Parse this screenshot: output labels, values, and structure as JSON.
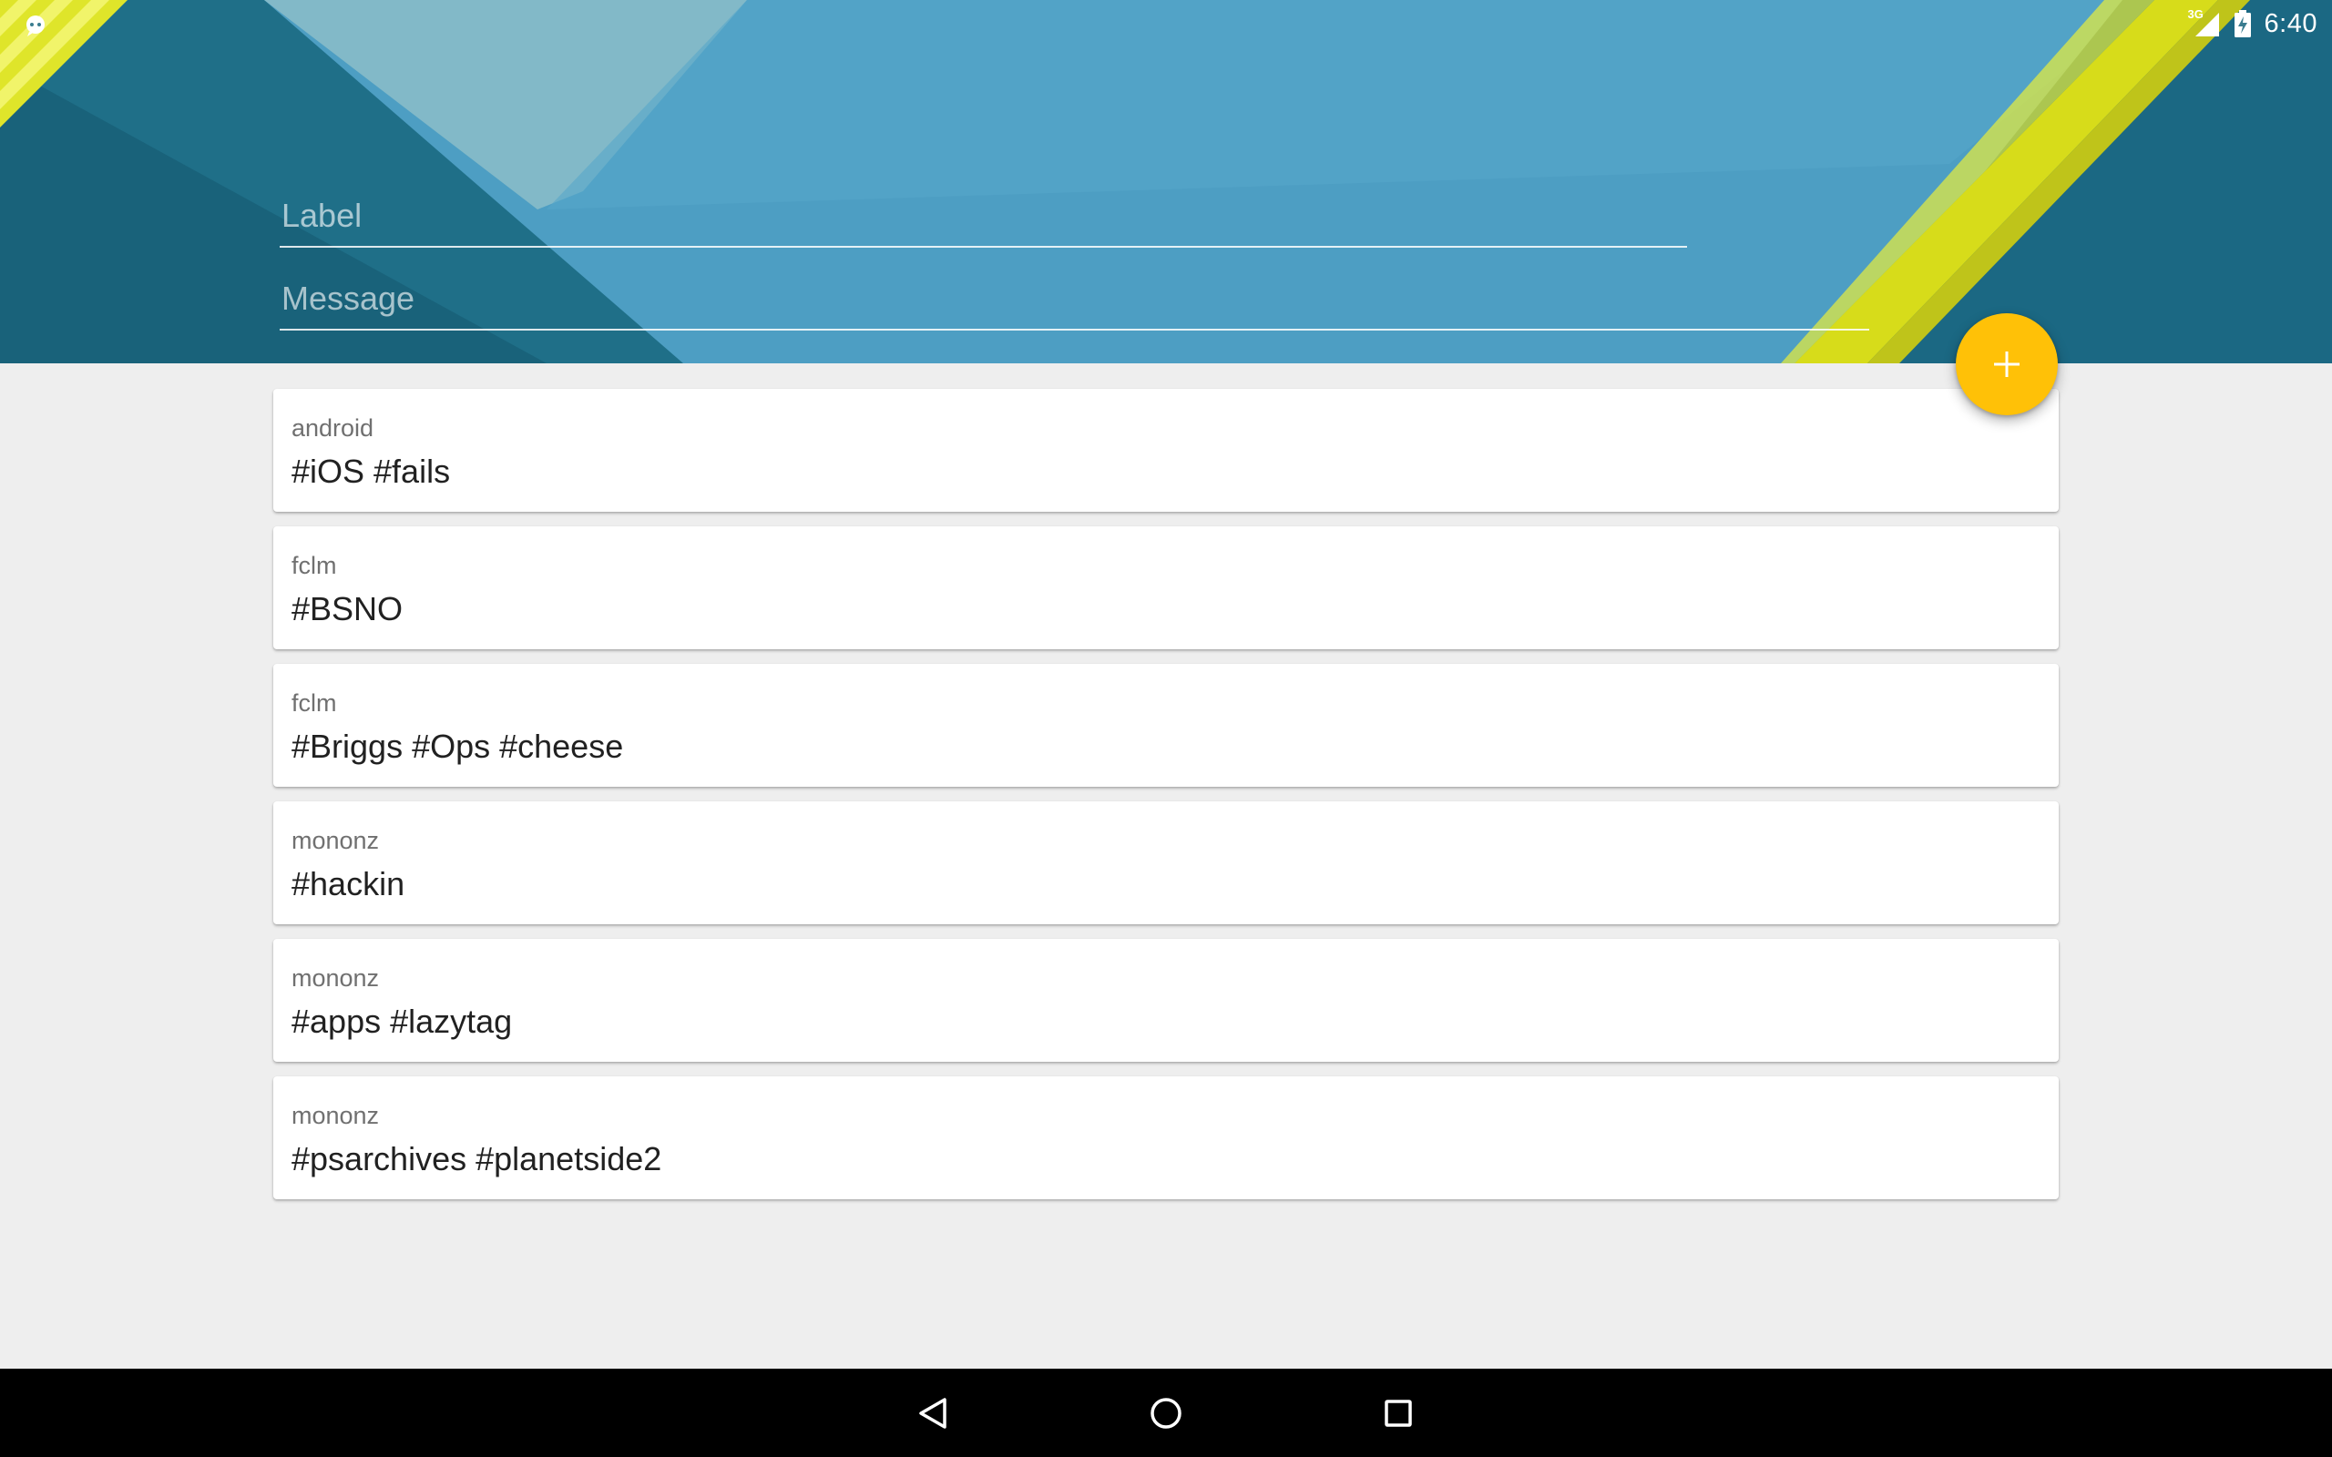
{
  "status_bar": {
    "time": "6:40",
    "network_type": "3G",
    "notification_icon": "notification-icon",
    "signal_icon": "signal-icon",
    "battery_icon": "battery-charging-icon"
  },
  "form": {
    "label_placeholder": "Label",
    "message_placeholder": "Message",
    "label_value": "",
    "message_value": ""
  },
  "fab": {
    "icon": "plus-icon",
    "color": "#ffc107"
  },
  "items": [
    {
      "label": "android",
      "message": "#iOS #fails"
    },
    {
      "label": "fclm",
      "message": "#BSNO"
    },
    {
      "label": "fclm",
      "message": "#Briggs #Ops #cheese"
    },
    {
      "label": "mononz",
      "message": "#hackin"
    },
    {
      "label": "mononz",
      "message": "#apps #lazytag"
    },
    {
      "label": "mononz",
      "message": "#psarchives #planetside2"
    }
  ],
  "nav_bar": {
    "back_icon": "back-icon",
    "home_icon": "home-icon",
    "recents_icon": "recents-icon"
  },
  "colors": {
    "accent": "#ffc107",
    "background": "#eeeeee",
    "header_dark": "#1f6f88",
    "header_light": "#4fa2c6",
    "wallpaper_yellow": "#dde21c"
  }
}
